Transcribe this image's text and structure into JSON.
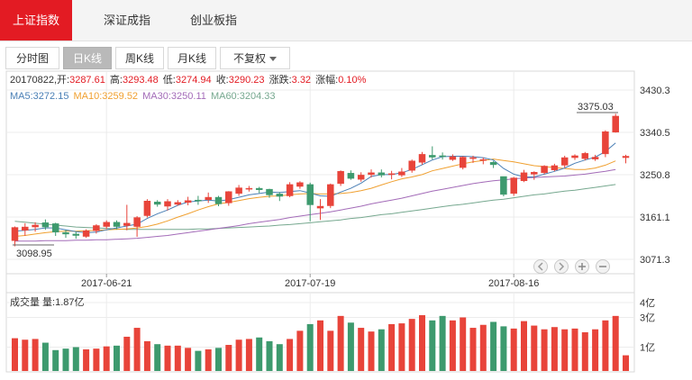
{
  "tabs": [
    {
      "label": "上证指数"
    },
    {
      "label": "深证成指"
    },
    {
      "label": "创业板指"
    }
  ],
  "subtabs": [
    {
      "label": "分时图"
    },
    {
      "label": "日K线"
    },
    {
      "label": "周K线"
    },
    {
      "label": "月K线"
    },
    {
      "label": "不复权"
    }
  ],
  "info": {
    "date": "20170822",
    "open_label": "开:",
    "open": "3287.61",
    "high_label": "高:",
    "high": "3293.48",
    "low_label": "低:",
    "low": "3274.94",
    "close_label": "收:",
    "close": "3290.23",
    "change_label": "涨跌:",
    "change": "3.32",
    "pct_label": "涨幅:",
    "pct": "0.10%"
  },
  "ma": {
    "ma5": "MA5:3272.15",
    "ma10": "MA10:3259.52",
    "ma30": "MA30:3250.11",
    "ma60": "MA60:3204.33"
  },
  "volume_label": "成交量 量:1.87亿",
  "colors": {
    "up": "#e8443a",
    "down": "#3d9a6e",
    "ma5": "#4a7fb5",
    "ma10": "#f0a030",
    "ma30": "#a36bb8",
    "ma60": "#76a88f",
    "accent": "#e31b23"
  },
  "chart_data": {
    "type": "candlestick",
    "price_ticks": [
      3430.3,
      3340.5,
      3250.8,
      3161.1,
      3071.3
    ],
    "volume_ticks": [
      "4亿",
      "3亿",
      "1亿"
    ],
    "x_labels": [
      {
        "label": "2017-06-21",
        "index": 9
      },
      {
        "label": "2017-07-19",
        "index": 29
      },
      {
        "label": "2017-08-16",
        "index": 49
      }
    ],
    "max_label": "3375.03",
    "min_label": "3098.95",
    "candles": [
      [
        3111,
        3139,
        3099,
        3141
      ],
      [
        3133,
        3140,
        3121,
        3148
      ],
      [
        3140,
        3144,
        3130,
        3150
      ],
      [
        3149,
        3140,
        3134,
        3156
      ],
      [
        3147,
        3129,
        3121,
        3149
      ],
      [
        3128,
        3125,
        3117,
        3134
      ],
      [
        3125,
        3122,
        3115,
        3130
      ],
      [
        3120,
        3132,
        3117,
        3135
      ],
      [
        3132,
        3143,
        3126,
        3146
      ],
      [
        3141,
        3150,
        3136,
        3154
      ],
      [
        3150,
        3141,
        3135,
        3154
      ],
      [
        3143,
        3148,
        3133,
        3187
      ],
      [
        3141,
        3160,
        3119,
        3163
      ],
      [
        3164,
        3195,
        3160,
        3199
      ],
      [
        3193,
        3188,
        3183,
        3197
      ],
      [
        3184,
        3194,
        3175,
        3199
      ],
      [
        3188,
        3192,
        3185,
        3197
      ],
      [
        3192,
        3196,
        3186,
        3204
      ],
      [
        3197,
        3196,
        3187,
        3206
      ],
      [
        3198,
        3203,
        3191,
        3213
      ],
      [
        3203,
        3189,
        3184,
        3206
      ],
      [
        3191,
        3215,
        3185,
        3216
      ],
      [
        3211,
        3223,
        3206,
        3229
      ],
      [
        3220,
        3222,
        3215,
        3227
      ],
      [
        3222,
        3219,
        3212,
        3225
      ],
      [
        3220,
        3208,
        3202,
        3221
      ],
      [
        3210,
        3205,
        3195,
        3214
      ],
      [
        3206,
        3230,
        3203,
        3235
      ],
      [
        3226,
        3234,
        3221,
        3237
      ],
      [
        3230,
        3187,
        3152,
        3234
      ],
      [
        3180,
        3184,
        3155,
        3199
      ],
      [
        3185,
        3230,
        3180,
        3232
      ],
      [
        3232,
        3258,
        3227,
        3260
      ],
      [
        3254,
        3243,
        3240,
        3260
      ],
      [
        3241,
        3250,
        3236,
        3256
      ],
      [
        3251,
        3255,
        3245,
        3262
      ],
      [
        3255,
        3250,
        3245,
        3262
      ],
      [
        3251,
        3253,
        3241,
        3259
      ],
      [
        3250,
        3257,
        3246,
        3265
      ],
      [
        3260,
        3280,
        3255,
        3283
      ],
      [
        3277,
        3294,
        3272,
        3299
      ],
      [
        3292,
        3288,
        3283,
        3311
      ],
      [
        3291,
        3290,
        3283,
        3298
      ],
      [
        3283,
        3289,
        3280,
        3294
      ],
      [
        3266,
        3288,
        3262,
        3290
      ],
      [
        3285,
        3287,
        3276,
        3291
      ],
      [
        3281,
        3283,
        3273,
        3287
      ],
      [
        3277,
        3272,
        3265,
        3280
      ],
      [
        3247,
        3209,
        3205,
        3247
      ],
      [
        3211,
        3244,
        3206,
        3246
      ],
      [
        3238,
        3255,
        3235,
        3261
      ],
      [
        3252,
        3256,
        3240,
        3258
      ],
      [
        3255,
        3269,
        3252,
        3271
      ],
      [
        3261,
        3270,
        3258,
        3274
      ],
      [
        3271,
        3287,
        3266,
        3291
      ],
      [
        3287,
        3291,
        3282,
        3294
      ],
      [
        3285,
        3296,
        3281,
        3299
      ],
      [
        3284,
        3288,
        3280,
        3293
      ],
      [
        3295,
        3342,
        3288,
        3345
      ],
      [
        3341,
        3375,
        3340,
        3380
      ],
      [
        3287,
        3290,
        3275,
        3293
      ]
    ],
    "ma5": [
      3131,
      3133,
      3135,
      3138,
      3138,
      3134,
      3130,
      3128,
      3129,
      3134,
      3138,
      3142,
      3146,
      3158,
      3168,
      3176,
      3186,
      3193,
      3195,
      3197,
      3195,
      3198,
      3203,
      3208,
      3211,
      3214,
      3213,
      3215,
      3217,
      3212,
      3206,
      3205,
      3214,
      3222,
      3233,
      3247,
      3251,
      3251,
      3255,
      3262,
      3272,
      3282,
      3289,
      3290,
      3290,
      3289,
      3287,
      3282,
      3264,
      3252,
      3246,
      3246,
      3252,
      3258,
      3265,
      3275,
      3282,
      3288,
      3300,
      3318,
      3272
    ],
    "ma10": [
      3120,
      3122,
      3125,
      3128,
      3130,
      3131,
      3131,
      3132,
      3133,
      3134,
      3135,
      3136,
      3138,
      3141,
      3146,
      3153,
      3161,
      3168,
      3176,
      3183,
      3189,
      3192,
      3196,
      3200,
      3203,
      3205,
      3206,
      3208,
      3210,
      3211,
      3210,
      3210,
      3211,
      3213,
      3217,
      3222,
      3229,
      3236,
      3242,
      3246,
      3251,
      3259,
      3264,
      3269,
      3274,
      3278,
      3281,
      3284,
      3281,
      3278,
      3274,
      3270,
      3268,
      3266,
      3264,
      3262,
      3262,
      3265,
      3271,
      3280,
      3260
    ],
    "ma30": [
      3110,
      3110,
      3110,
      3111,
      3111,
      3111,
      3112,
      3112,
      3113,
      3113,
      3114,
      3115,
      3116,
      3118,
      3120,
      3122,
      3125,
      3128,
      3131,
      3134,
      3137,
      3140,
      3143,
      3147,
      3150,
      3153,
      3156,
      3160,
      3163,
      3166,
      3169,
      3172,
      3176,
      3180,
      3184,
      3189,
      3193,
      3197,
      3201,
      3206,
      3211,
      3216,
      3220,
      3224,
      3228,
      3232,
      3235,
      3238,
      3240,
      3242,
      3244,
      3245,
      3246,
      3247,
      3248,
      3250,
      3252,
      3255,
      3258,
      3262,
      3250
    ],
    "ma60": [
      3152,
      3150,
      3148,
      3146,
      3144,
      3142,
      3140,
      3139,
      3138,
      3137,
      3136,
      3135,
      3135,
      3135,
      3135,
      3135,
      3135,
      3135,
      3136,
      3136,
      3137,
      3138,
      3139,
      3140,
      3141,
      3142,
      3144,
      3145,
      3147,
      3149,
      3151,
      3153,
      3155,
      3158,
      3160,
      3163,
      3166,
      3168,
      3171,
      3174,
      3177,
      3180,
      3183,
      3186,
      3188,
      3191,
      3194,
      3197,
      3199,
      3202,
      3205,
      3208,
      3210,
      3213,
      3216,
      3218,
      3221,
      3224,
      3227,
      3230,
      3204
    ],
    "volumes": [
      1.6,
      1.5,
      1.55,
      1.3,
      0.8,
      0.9,
      1.0,
      0.85,
      0.9,
      1.05,
      1.1,
      1.7,
      2.3,
      1.4,
      1.2,
      1.1,
      1.1,
      0.95,
      0.75,
      0.85,
      0.95,
      1.15,
      1.5,
      1.55,
      1.65,
      1.4,
      1.2,
      1.55,
      2.1,
      2.55,
      2.8,
      2.1,
      3.1,
      2.65,
      2.3,
      2.05,
      2.2,
      2.55,
      2.6,
      2.9,
      3.15,
      2.8,
      3.1,
      2.8,
      3.0,
      2.3,
      2.5,
      2.7,
      2.4,
      2.25,
      2.75,
      2.45,
      2.2,
      2.35,
      2.2,
      2.25,
      2.0,
      2.2,
      2.8,
      3.1,
      0.45
    ]
  }
}
